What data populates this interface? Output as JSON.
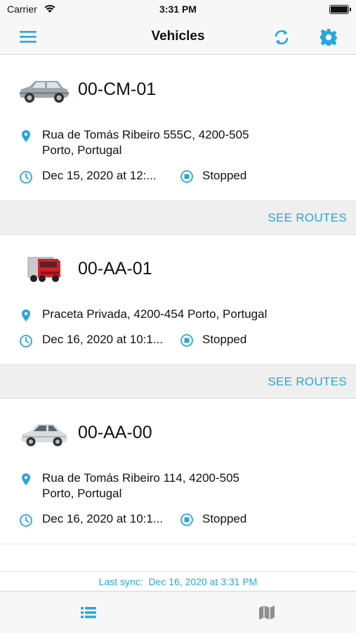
{
  "status_bar": {
    "carrier": "Carrier",
    "time": "3:31 PM"
  },
  "nav": {
    "title": "Vehicles"
  },
  "vehicles": [
    {
      "plate": "00-CM-01",
      "address_line1": "Rua de Tomás Ribeiro 555C, 4200-505",
      "address_line2": "Porto, Portugal",
      "date": "Dec 15, 2020 at 12:...",
      "status": "Stopped",
      "action": "SEE ROUTES",
      "icon": "suv-icon"
    },
    {
      "plate": "00-AA-01",
      "address_line1": "Praceta Privada, 4200-454 Porto, Portugal",
      "address_line2": "",
      "date": "Dec 16, 2020 at 10:1...",
      "status": "Stopped",
      "action": "SEE ROUTES",
      "icon": "truck-icon"
    },
    {
      "plate": "00-AA-00",
      "address_line1": "Rua de Tomás Ribeiro 114, 4200-505",
      "address_line2": "Porto, Portugal",
      "date": "Dec 16, 2020 at 10:1...",
      "status": "Stopped",
      "icon": "car-icon"
    }
  ],
  "footer": {
    "sync_label": "Last sync:",
    "sync_value": "Dec 16, 2020 at 3:31 PM"
  },
  "colors": {
    "accent": "#2aa6d9",
    "truck": "#d0212a"
  }
}
